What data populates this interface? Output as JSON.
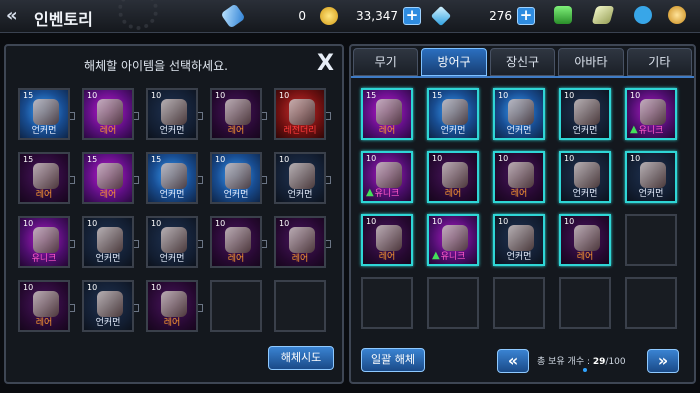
{
  "topbar": {
    "title": "인벤토리",
    "currencies": [
      {
        "icon": "energy-capsule-icon",
        "value": "0",
        "has_plus": false
      },
      {
        "icon": "gold-coin-icon",
        "value": "33,347",
        "has_plus": true
      },
      {
        "icon": "diamond-icon",
        "value": "276",
        "has_plus": true
      }
    ],
    "side_icons": [
      "transfer-icon",
      "quest-icon",
      "chat-icon",
      "settings-icon"
    ]
  },
  "left_panel": {
    "header": "해체할 아이템을 선택하세요.",
    "close_label": "X",
    "dismantle_button": "해체시도",
    "items": [
      {
        "level": "15",
        "grade": "언커먼",
        "rarity": "common",
        "glyph": "revolver-icon",
        "highlight": false
      },
      {
        "level": "10",
        "grade": "레어",
        "rarity": "rare",
        "glyph": "pistol-icon",
        "highlight": false
      },
      {
        "level": "10",
        "grade": "언커먼",
        "rarity": "common-dark",
        "glyph": "glove-icon",
        "highlight": false
      },
      {
        "level": "10",
        "grade": "레어",
        "rarity": "rare-dark",
        "glyph": "glove-icon",
        "highlight": false
      },
      {
        "level": "10",
        "grade": "레전더리",
        "rarity": "legend",
        "glyph": "knife-icon",
        "highlight": false
      },
      {
        "level": "15",
        "grade": "레어",
        "rarity": "rare-dark",
        "glyph": "rifle-icon",
        "highlight": false
      },
      {
        "level": "15",
        "grade": "레어",
        "rarity": "rare",
        "glyph": "chain-armor-icon",
        "highlight": false
      },
      {
        "level": "15",
        "grade": "언커먼",
        "rarity": "common",
        "glyph": "vest-icon",
        "highlight": false
      },
      {
        "level": "10",
        "grade": "언커먼",
        "rarity": "common",
        "glyph": "gauntlet-icon",
        "highlight": false
      },
      {
        "level": "10",
        "grade": "언커먼",
        "rarity": "common-dark",
        "glyph": "gauntlet-icon",
        "highlight": false
      },
      {
        "level": "10",
        "grade": "유니크",
        "rarity": "unique",
        "glyph": "leg-armor-icon",
        "highlight": false
      },
      {
        "level": "10",
        "grade": "언커먼",
        "rarity": "common-dark",
        "glyph": "boots-icon",
        "highlight": false
      },
      {
        "level": "10",
        "grade": "언커먼",
        "rarity": "common-dark",
        "glyph": "pants-icon",
        "highlight": false
      },
      {
        "level": "10",
        "grade": "레어",
        "rarity": "rare-dark",
        "glyph": "leg-armor-icon",
        "highlight": false
      },
      {
        "level": "10",
        "grade": "레어",
        "rarity": "rare-dark",
        "glyph": "leg-armor-icon",
        "highlight": false
      },
      {
        "level": "10",
        "grade": "레어",
        "rarity": "rare-dark",
        "glyph": "boots-icon",
        "highlight": false
      },
      {
        "level": "10",
        "grade": "언커먼",
        "rarity": "common-dark",
        "glyph": "boots-icon",
        "highlight": false
      },
      {
        "level": "10",
        "grade": "레어",
        "rarity": "rare-dark",
        "glyph": "belt-icon",
        "highlight": false
      },
      {
        "level": "",
        "grade": "",
        "rarity": "empty",
        "glyph": "",
        "highlight": false
      },
      {
        "level": "",
        "grade": "",
        "rarity": "empty",
        "glyph": "",
        "highlight": false
      }
    ]
  },
  "right_panel": {
    "tabs": [
      {
        "label": "무기",
        "active": false
      },
      {
        "label": "방어구",
        "active": true
      },
      {
        "label": "장신구",
        "active": false
      },
      {
        "label": "아바타",
        "active": false
      },
      {
        "label": "기타",
        "active": false
      }
    ],
    "bulk_button": "일괄 해체",
    "prev_icon": "«",
    "next_icon": "»",
    "count_label": "총 보유 개수 : ",
    "count_value": "29",
    "count_max": "/100",
    "items": [
      {
        "level": "15",
        "grade": "레어",
        "rarity": "rare",
        "glyph": "chain-armor-icon",
        "up": false
      },
      {
        "level": "15",
        "grade": "언커먼",
        "rarity": "common",
        "glyph": "vest-icon",
        "up": false
      },
      {
        "level": "10",
        "grade": "언커먼",
        "rarity": "common",
        "glyph": "gauntlet-icon",
        "up": false
      },
      {
        "level": "10",
        "grade": "언커먼",
        "rarity": "common-dark",
        "glyph": "gauntlet-icon",
        "up": false
      },
      {
        "level": "10",
        "grade": "유니크",
        "rarity": "unique",
        "glyph": "leg-armor-icon",
        "up": true
      },
      {
        "level": "10",
        "grade": "유니크",
        "rarity": "unique",
        "glyph": "leg-armor-icon",
        "up": true
      },
      {
        "level": "10",
        "grade": "레어",
        "rarity": "rare-dark",
        "glyph": "leg-armor-icon",
        "up": false
      },
      {
        "level": "10",
        "grade": "레어",
        "rarity": "rare-dark",
        "glyph": "leg-armor-icon",
        "up": false
      },
      {
        "level": "10",
        "grade": "언커먼",
        "rarity": "common-dark",
        "glyph": "pants-icon",
        "up": false
      },
      {
        "level": "10",
        "grade": "언커먼",
        "rarity": "common-dark",
        "glyph": "leg-armor-icon",
        "up": false
      },
      {
        "level": "10",
        "grade": "레어",
        "rarity": "rare-dark",
        "glyph": "boots-icon",
        "up": false
      },
      {
        "level": "10",
        "grade": "유니크",
        "rarity": "unique",
        "glyph": "belt-icon",
        "up": true
      },
      {
        "level": "10",
        "grade": "언커먼",
        "rarity": "common-dark",
        "glyph": "boots-icon",
        "up": false
      },
      {
        "level": "10",
        "grade": "레어",
        "rarity": "rare-dark",
        "glyph": "belt-icon",
        "up": false
      },
      {
        "level": "",
        "grade": "",
        "rarity": "empty",
        "glyph": "",
        "up": false
      },
      {
        "level": "",
        "grade": "",
        "rarity": "empty",
        "glyph": "",
        "up": false
      },
      {
        "level": "",
        "grade": "",
        "rarity": "empty",
        "glyph": "",
        "up": false
      },
      {
        "level": "",
        "grade": "",
        "rarity": "empty",
        "glyph": "",
        "up": false
      },
      {
        "level": "",
        "grade": "",
        "rarity": "empty",
        "glyph": "",
        "up": false
      },
      {
        "level": "",
        "grade": "",
        "rarity": "empty",
        "glyph": "",
        "up": false
      }
    ]
  },
  "colors": {
    "accent": "#2f8ce0",
    "highlight": "#2fd6d6",
    "grade_common": "#e8f0ff",
    "grade_rare": "#ff9a30",
    "grade_unique": "#ff59c8",
    "grade_legend": "#ff3b3b"
  }
}
